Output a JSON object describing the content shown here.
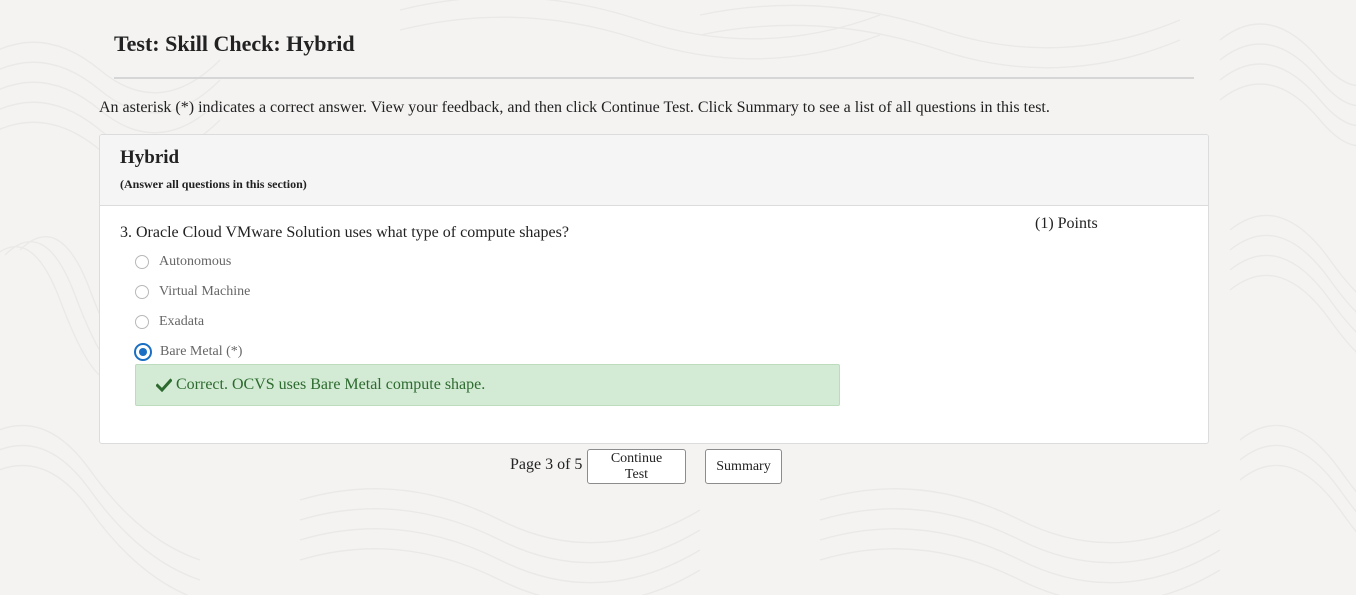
{
  "page": {
    "title": "Test: Skill Check: Hybrid",
    "instructions": "An asterisk (*) indicates a correct answer. View your feedback, and then click Continue Test. Click Summary to see a list of all questions in this test."
  },
  "section": {
    "title": "Hybrid",
    "subtitle": "(Answer all questions in this section)"
  },
  "question": {
    "text": "3. Oracle Cloud VMware Solution uses what type of compute shapes?",
    "points": "(1) Points",
    "options": [
      {
        "label": "Autonomous",
        "selected": false
      },
      {
        "label": "Virtual Machine",
        "selected": false
      },
      {
        "label": "Exadata",
        "selected": false
      },
      {
        "label": "Bare Metal (*)",
        "selected": true
      }
    ],
    "feedback": {
      "icon": "check-icon",
      "text": "Correct. OCVS uses Bare Metal compute shape.",
      "color": "#2d6a2f",
      "background": "#d3ebd4"
    }
  },
  "navigation": {
    "page_label": "Page 3 of 5",
    "continue_label": "Continue Test",
    "summary_label": "Summary"
  },
  "colors": {
    "accent": "#1a6fc4"
  }
}
